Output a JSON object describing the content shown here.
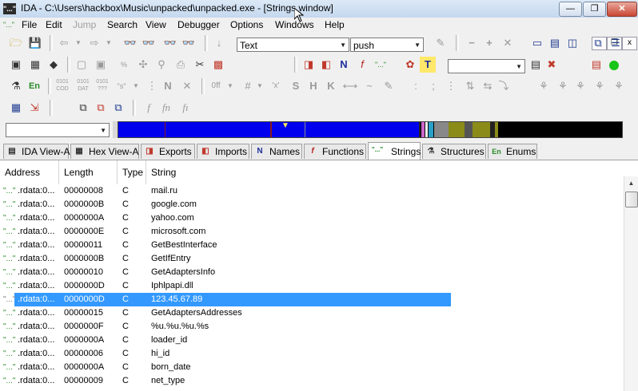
{
  "window": {
    "title": "IDA - C:\\Users\\hackbox\\Music\\unpacked\\unpacked.exe - [Strings window]",
    "app_icon_text": "\"...\"",
    "minimize": "—",
    "maximize": "❐",
    "close": "✕"
  },
  "menu": {
    "icon_text": "\"...\"",
    "items": [
      {
        "label": "File",
        "enabled": true
      },
      {
        "label": "Edit",
        "enabled": true
      },
      {
        "label": "Jump",
        "enabled": false
      },
      {
        "label": "Search",
        "enabled": true
      },
      {
        "label": "View",
        "enabled": true
      },
      {
        "label": "Debugger",
        "enabled": true
      },
      {
        "label": "Options",
        "enabled": true
      },
      {
        "label": "Windows",
        "enabled": true
      },
      {
        "label": "Help",
        "enabled": true
      }
    ],
    "mdi": {
      "minimize": "_",
      "restore": "❐",
      "close": "x"
    }
  },
  "toolbar": {
    "text_combo": "Text",
    "search_combo": "push",
    "empty_combo": "",
    "segment_combo": ""
  },
  "tabs": [
    {
      "label": "IDA View-A",
      "icon": "ida-view-icon",
      "glyph": "▤",
      "color": "#333",
      "active": false
    },
    {
      "label": "Hex View-A",
      "icon": "hex-view-icon",
      "glyph": "▦",
      "color": "#333",
      "active": false
    },
    {
      "label": "Exports",
      "icon": "exports-icon",
      "glyph": "◨",
      "color": "#c0392b",
      "active": false
    },
    {
      "label": "Imports",
      "icon": "imports-icon",
      "glyph": "◧",
      "color": "#c0392b",
      "active": false
    },
    {
      "label": "Names",
      "icon": "names-icon",
      "glyph": "N",
      "color": "#1c2f9b",
      "active": false
    },
    {
      "label": "Functions",
      "icon": "functions-icon",
      "glyph": "f",
      "color": "#b3261e",
      "active": false
    },
    {
      "label": "Strings",
      "icon": "strings-icon",
      "glyph": "\"...\"",
      "color": "#2a8a2a",
      "active": true
    },
    {
      "label": "Structures",
      "icon": "structures-icon",
      "glyph": "⚗",
      "color": "#333",
      "active": false
    },
    {
      "label": "Enums",
      "icon": "enums-icon",
      "glyph": "En",
      "color": "#2a8a2a",
      "active": false
    }
  ],
  "table": {
    "columns": [
      "Address",
      "Length",
      "Type",
      "String"
    ],
    "row_icon": "\"...\"",
    "rows": [
      {
        "address": ".rdata:0...",
        "length": "00000008",
        "type": "C",
        "string": "mail.ru"
      },
      {
        "address": ".rdata:0...",
        "length": "0000000B",
        "type": "C",
        "string": "google.com"
      },
      {
        "address": ".rdata:0...",
        "length": "0000000A",
        "type": "C",
        "string": "yahoo.com"
      },
      {
        "address": ".rdata:0...",
        "length": "0000000E",
        "type": "C",
        "string": "microsoft.com"
      },
      {
        "address": ".rdata:0...",
        "length": "00000011",
        "type": "C",
        "string": "GetBestInterface"
      },
      {
        "address": ".rdata:0...",
        "length": "0000000B",
        "type": "C",
        "string": "GetIfEntry"
      },
      {
        "address": ".rdata:0...",
        "length": "00000010",
        "type": "C",
        "string": "GetAdaptersInfo"
      },
      {
        "address": ".rdata:0...",
        "length": "0000000D",
        "type": "C",
        "string": "Iphlpapi.dll"
      },
      {
        "address": ".rdata:0...",
        "length": "0000000D",
        "type": "C",
        "string": "123.45.67.89",
        "selected": true
      },
      {
        "address": ".rdata:0...",
        "length": "00000015",
        "type": "C",
        "string": "GetAdaptersAddresses"
      },
      {
        "address": ".rdata:0...",
        "length": "0000000F",
        "type": "C",
        "string": "%u.%u.%u.%s"
      },
      {
        "address": ".rdata:0...",
        "length": "0000000A",
        "type": "C",
        "string": "loader_id"
      },
      {
        "address": ".rdata:0...",
        "length": "00000006",
        "type": "C",
        "string": "hi_id"
      },
      {
        "address": ".rdata:0...",
        "length": "0000000A",
        "type": "C",
        "string": "born_date"
      },
      {
        "address": ".rdata:0...",
        "length": "00000009",
        "type": "C",
        "string": "net_type"
      }
    ]
  },
  "colors": {
    "selection": "#3399ff",
    "band_code": "#0000ee",
    "band_data": "#8b8b1a",
    "band_unexplored": "#000000"
  }
}
